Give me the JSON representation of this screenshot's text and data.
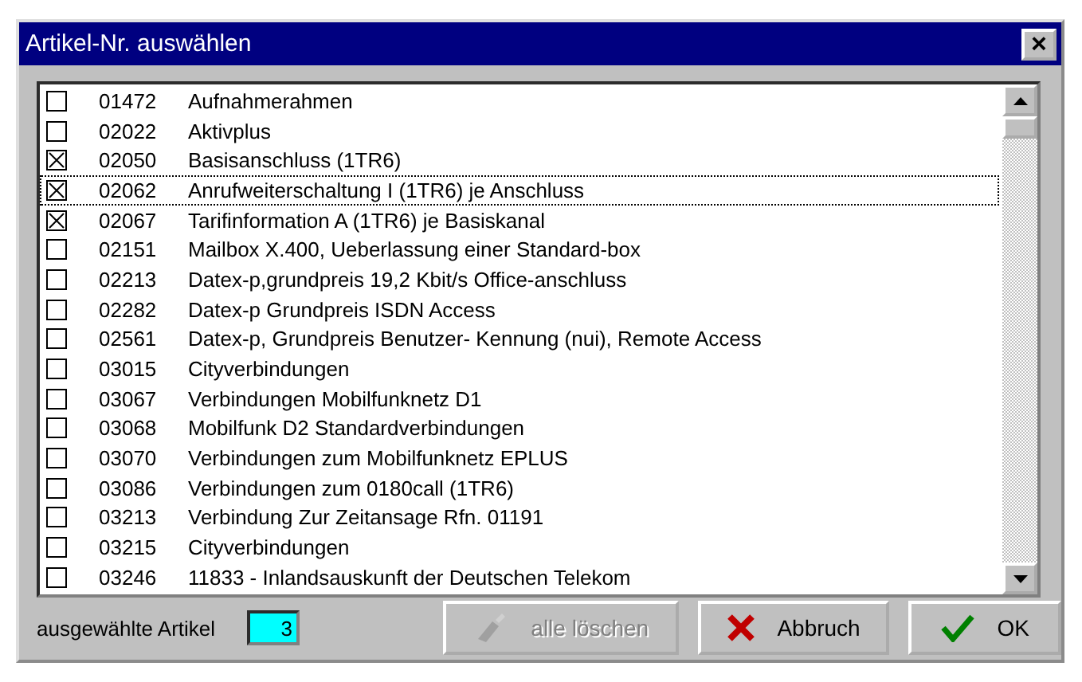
{
  "window": {
    "title": "Artikel-Nr. auswählen",
    "close": "×"
  },
  "items": [
    {
      "number": "01472",
      "name": "Aufnahmerahmen",
      "checked": false,
      "focused": false
    },
    {
      "number": "02022",
      "name": "Aktivplus",
      "checked": false,
      "focused": false
    },
    {
      "number": "02050",
      "name": "Basisanschluss (1TR6)",
      "checked": true,
      "focused": false
    },
    {
      "number": "02062",
      "name": "Anrufweiterschaltung I (1TR6) je Anschluss",
      "checked": true,
      "focused": true
    },
    {
      "number": "02067",
      "name": "Tarifinformation A (1TR6) je Basiskanal",
      "checked": true,
      "focused": false
    },
    {
      "number": "02151",
      "name": "Mailbox X.400, Ueberlassung einer Standard-box",
      "checked": false,
      "focused": false
    },
    {
      "number": "02213",
      "name": "Datex-p,grundpreis 19,2 Kbit/s Office-anschluss",
      "checked": false,
      "focused": false
    },
    {
      "number": "02282",
      "name": "Datex-p Grundpreis ISDN Access",
      "checked": false,
      "focused": false
    },
    {
      "number": "02561",
      "name": "Datex-p, Grundpreis Benutzer- Kennung (nui), Remote Access",
      "checked": false,
      "focused": false
    },
    {
      "number": "03015",
      "name": "Cityverbindungen",
      "checked": false,
      "focused": false
    },
    {
      "number": "03067",
      "name": "Verbindungen Mobilfunknetz D1",
      "checked": false,
      "focused": false
    },
    {
      "number": "03068",
      "name": "Mobilfunk D2 Standardverbindungen",
      "checked": false,
      "focused": false
    },
    {
      "number": "03070",
      "name": "Verbindungen zum Mobilfunknetz EPLUS",
      "checked": false,
      "focused": false
    },
    {
      "number": "03086",
      "name": "Verbindungen zum 0180call (1TR6)",
      "checked": false,
      "focused": false
    },
    {
      "number": "03213",
      "name": "Verbindung Zur Zeitansage Rfn. 01191",
      "checked": false,
      "focused": false
    },
    {
      "number": "03215",
      "name": "Cityverbindungen",
      "checked": false,
      "focused": false
    },
    {
      "number": "03246",
      "name": "11833 - Inlandsauskunft der Deutschen Telekom",
      "checked": false,
      "focused": false
    }
  ],
  "footer": {
    "label": "ausgewählte Artikel",
    "count": "3"
  },
  "buttons": [
    {
      "kind": "clear",
      "label": "alle löschen",
      "disabled": true
    },
    {
      "kind": "cancel",
      "label": "Abbruch",
      "disabled": false
    },
    {
      "kind": "ok",
      "label": "OK",
      "disabled": false
    }
  ]
}
